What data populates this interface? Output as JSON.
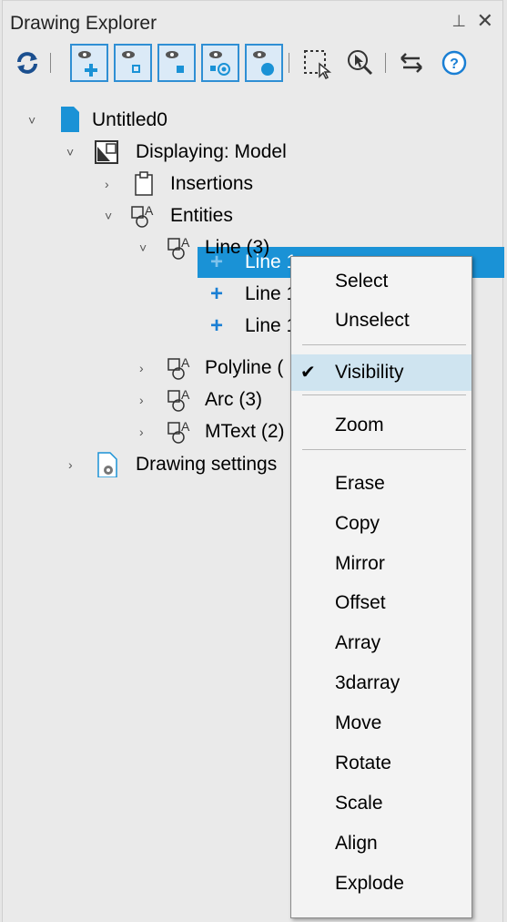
{
  "panel": {
    "title": "Drawing Explorer",
    "pin_glyph": "⊥",
    "close_glyph": "✕"
  },
  "toolbar": {
    "buttons": [
      {
        "name": "refresh-icon"
      },
      {
        "name": "add-view-icon"
      },
      {
        "name": "view-small-icon"
      },
      {
        "name": "view-medium-icon"
      },
      {
        "name": "view-target-icon"
      },
      {
        "name": "view-large-icon"
      },
      {
        "name": "window-select-icon"
      },
      {
        "name": "find-zoom-icon"
      },
      {
        "name": "swap-arrows-icon"
      },
      {
        "name": "help-icon"
      }
    ],
    "help_glyph": "?"
  },
  "tree": {
    "root": "Untitled0",
    "displaying": "Displaying: Model",
    "insertions": "Insertions",
    "entities": "Entities",
    "line_group": "Line (3)",
    "line_items": [
      "Line 1",
      "Line 1",
      "Line 1"
    ],
    "polyline": "Polyline (",
    "arc": "Arc (3)",
    "mtext": "MText (2)",
    "drawing_settings": "Drawing settings"
  },
  "context_menu": {
    "check_glyph": "✔",
    "items": [
      "Select",
      "Unselect",
      "Visibility",
      "Zoom",
      "Erase",
      "Copy",
      "Mirror",
      "Offset",
      "Array",
      "3darray",
      "Move",
      "Rotate",
      "Scale",
      "Align",
      "Explode"
    ]
  },
  "colors": {
    "accent": "#1a92d6",
    "tree_plus": "#1a7fd4",
    "checked_bg": "#cfe4f0"
  }
}
